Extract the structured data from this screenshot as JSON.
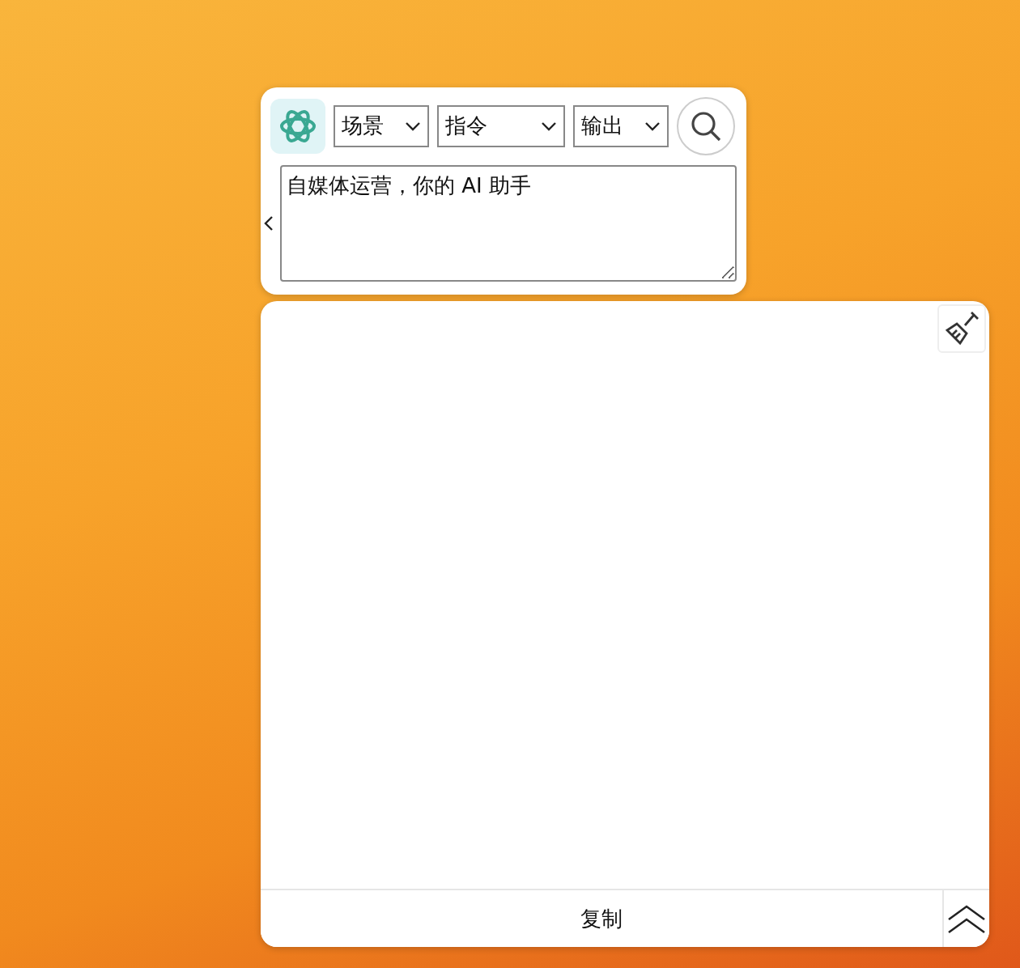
{
  "toolbar": {
    "selects": [
      {
        "value": "场景"
      },
      {
        "value": "指令"
      },
      {
        "value": "输出"
      }
    ]
  },
  "prompt": {
    "value": "自媒体运营，你的 AI 助手"
  },
  "output": {
    "copy_button": "复制"
  }
}
